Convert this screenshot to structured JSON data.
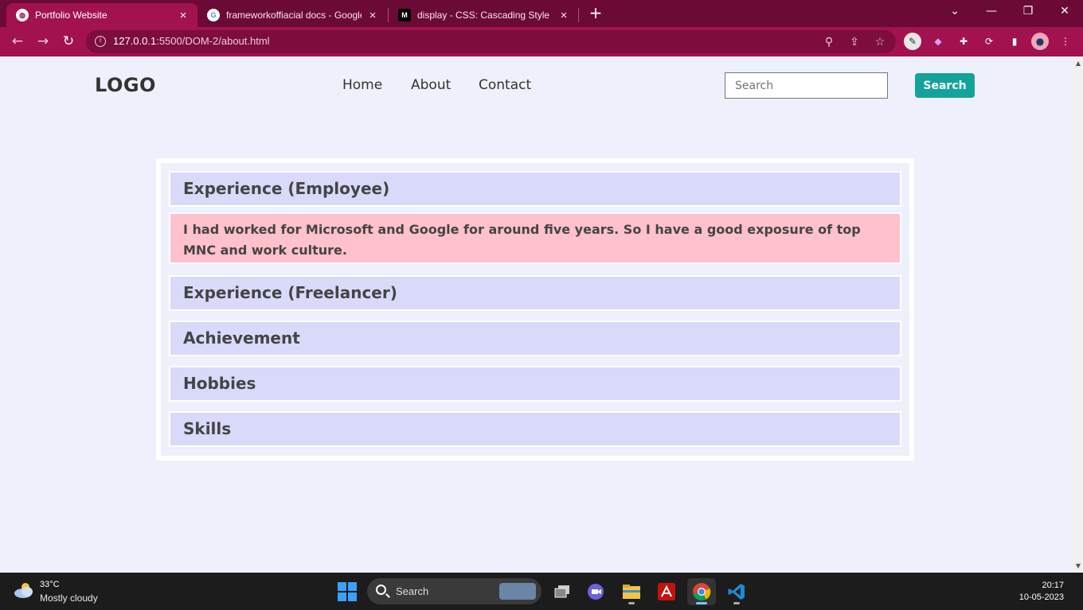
{
  "browser": {
    "tabs": [
      {
        "title": "Portfolio Website",
        "active": true,
        "favicon": "globe-icon"
      },
      {
        "title": "frameworkoffiacial docs - Google",
        "active": false,
        "favicon": "google-icon"
      },
      {
        "title": "display - CSS: Cascading Style Sh",
        "active": false,
        "favicon": "mdn-icon"
      }
    ],
    "url_host": "127.0.0.1",
    "url_path": ":5500/DOM-2/about.html",
    "colors": {
      "frame": "#6b0a35",
      "toolbar": "#a1124f",
      "omnibox": "#7c0d3c"
    }
  },
  "site": {
    "logo": "LOGO",
    "nav": [
      "Home",
      "About",
      "Contact"
    ],
    "search_placeholder": "Search",
    "search_button": "Search",
    "colors": {
      "accent": "#14a39a",
      "header_bg": "#d9dafa",
      "body_bg": "#ffc1cb"
    }
  },
  "accordion": {
    "items": [
      {
        "title": "Experience (Employee)",
        "expanded": true
      },
      {
        "title": "Experience (Freelancer)",
        "expanded": false
      },
      {
        "title": "Achievement",
        "expanded": false
      },
      {
        "title": "Hobbies",
        "expanded": false
      },
      {
        "title": "Skills",
        "expanded": false
      }
    ],
    "expanded_text": "I had worked for Microsoft and Google for around five years. So I have a good exposure of top MNC and work culture."
  },
  "taskbar": {
    "weather_temp": "33°C",
    "weather_desc": "Mostly cloudy",
    "search_label": "Search",
    "time": "20:17",
    "date": "10-05-2023",
    "apps": [
      "file-explorer-icon",
      "teams-icon",
      "folder-icon",
      "pdf-icon",
      "chrome-icon",
      "vscode-icon"
    ]
  }
}
